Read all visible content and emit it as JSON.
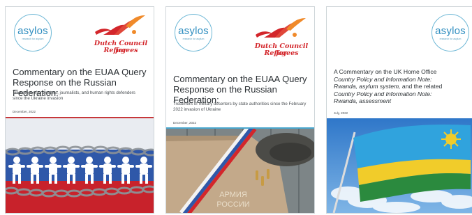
{
  "colors": {
    "asylos_blue": "#2f8ec0",
    "dutch_council_red": "#d3262b",
    "accent_line_red": "#c7373a",
    "accent_line_blue": "#4aa7cf"
  },
  "covers": [
    {
      "logo_main": "asylos",
      "logo_tagline": "research for asylum",
      "partner_logo": "Dutch Council for Refugees",
      "partner_logo_line1": "Dutch Council for",
      "partner_logo_line2": "Refugees",
      "title": "Commentary on the EUAA Query Response on the Russian Federation:",
      "subtitle": "Treatment of protesters, journalists, and human rights defenders since the Ukraine invasion",
      "date": "December, 2022",
      "image": "paper-people-chain-russian-flag"
    },
    {
      "logo_main": "asylos",
      "logo_tagline": "research for asylum",
      "partner_logo": "Dutch Council for Refugees",
      "partner_logo_line1": "Dutch Council for",
      "partner_logo_line2": "Refugees",
      "title": "Commentary on the EUAA Query Response on the Russian Federation:",
      "subtitle": "Treatment of military deserters by state authorities since the February 2022 invasion of Ukraine",
      "date": "December, 2022",
      "image_text_line1": "АРМИЯ",
      "image_text_line2": "РОССИИ",
      "image": "military-shirt-with-russian-flag-ribbon"
    },
    {
      "logo_main": "asylos",
      "logo_tagline": "research for asylum",
      "title_line1": "A Commentary on the UK Home Office",
      "title_line2": "Country Policy and Information Note:",
      "title_line3": "Rwanda, asylum system,",
      "title_line3_tail": " and the related",
      "title_line4": "Country Policy and Information Note:",
      "title_line5": "Rwanda, assessment",
      "date": "July, 2022",
      "image": "rwanda-flag-blue-sky"
    }
  ]
}
